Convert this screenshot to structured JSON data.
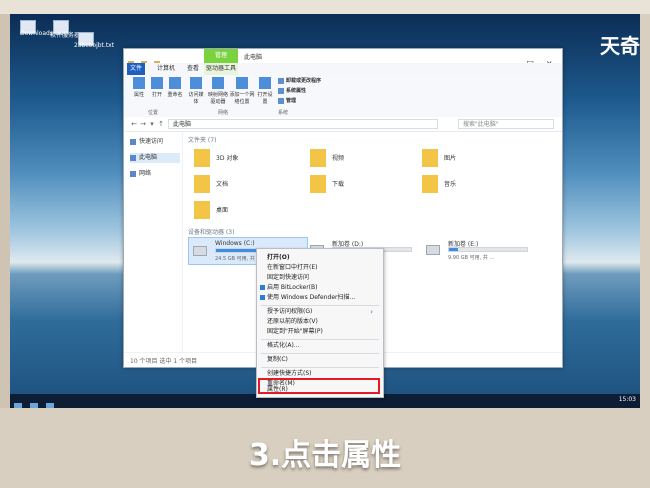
{
  "brand": "天奇",
  "desktop": {
    "labels": [
      "Downloads.txt",
      "软件服务器.txt",
      "23bcoojbt.txt"
    ]
  },
  "window": {
    "title": "此电脑",
    "context_tab": "管理",
    "tabs": [
      "文件",
      "计算机",
      "查看",
      "驱动器工具"
    ],
    "ribbon": {
      "buttons": [
        "属性",
        "打开",
        "重命名",
        "访问媒体",
        "映射网络驱动器",
        "添加一个网络位置",
        "打开设置"
      ],
      "groups": [
        "位置",
        "网络",
        "系统"
      ],
      "system_items": [
        "卸载或更改程序",
        "系统属性",
        "管理"
      ]
    },
    "address": "此电脑",
    "search_placeholder": "搜索\"此电脑\"",
    "sidebar": [
      "快速访问",
      "此电脑",
      "网络"
    ],
    "sections": {
      "folders_title": "文件夹 (7)",
      "devices_title": "设备和驱动器 (3)"
    },
    "folders": [
      "3D 对象",
      "视频",
      "图片",
      "文档",
      "下载",
      "音乐",
      "桌面"
    ],
    "drives": [
      {
        "name": "Windows (C:)",
        "space": "24.5 GB 可用, 共 ...",
        "fill": 0.82
      },
      {
        "name": "新加卷 (D:)",
        "space": "",
        "fill": 0.62
      },
      {
        "name": "新加卷 (E:)",
        "space": "9.90 GB 可用, 共 ...",
        "fill": 0.12
      }
    ],
    "status": "10 个项目   选中 1 个项目"
  },
  "context_menu": [
    "打开(O)",
    "在新窗口中打开(E)",
    "固定到快速访问",
    "启用 BitLocker(B)",
    "使用 Windows Defender扫描...",
    "授予访问权限(G)",
    "还原以前的版本(V)",
    "固定到\"开始\"屏幕(P)",
    "格式化(A)...",
    "复制(C)",
    "创建快捷方式(S)",
    "重命名(M)",
    "属性(R)"
  ],
  "taskbar": {
    "time": "15:03"
  },
  "caption": "3.点击属性"
}
